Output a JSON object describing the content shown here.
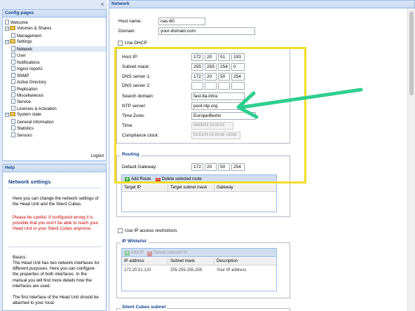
{
  "left": {
    "config_header": "Config pages",
    "collapse_icon": "«",
    "tree": [
      {
        "label": "Welcome",
        "icon": "page-icon"
      },
      {
        "label": "Volumes & Shares",
        "icon": "folder-icon"
      },
      {
        "label": "Management",
        "icon": "page-icon"
      },
      {
        "label": "Settings",
        "icon": "folder-icon"
      },
      {
        "label": "Network",
        "icon": "page-icon",
        "selected": true
      },
      {
        "label": "User",
        "icon": "page-icon"
      },
      {
        "label": "Notifications",
        "icon": "page-icon"
      },
      {
        "label": "Ingest reports",
        "icon": "page-icon"
      },
      {
        "label": "SNMP",
        "icon": "page-icon"
      },
      {
        "label": "Active Directory",
        "icon": "page-icon"
      },
      {
        "label": "Replication",
        "icon": "page-icon"
      },
      {
        "label": "Miscellaneous",
        "icon": "page-icon"
      },
      {
        "label": "Service",
        "icon": "page-icon"
      },
      {
        "label": "Licenses & Activation",
        "icon": "page-icon"
      },
      {
        "label": "System state",
        "icon": "folder-icon"
      },
      {
        "label": "General information",
        "icon": "page-icon"
      },
      {
        "label": "Statistics",
        "icon": "page-icon"
      },
      {
        "label": "Sensors",
        "icon": "page-icon"
      }
    ],
    "logout": "Logout",
    "help_header": "Help",
    "help_title": "Network settings",
    "help_p1": "Here you can change the network settings of the Head Unit and the Silent Cubes.",
    "help_warning": "Please be careful: if configured wrong it is possible that you won't be able to reach your Head Unit or your Silent Cubes anymore.",
    "help_basics_title": "Basics:",
    "help_p2": "The Head Unit has two network interfaces for different purposes. Here you can configure the properties of both interfaces. In the manual you will find more details how the interfaces are used.",
    "help_p3": "The first interface of the Head Unit should be attached to your local"
  },
  "main": {
    "header": "Network",
    "host_name_label": "Host name:",
    "host_name_value": "nas-60",
    "domain_label": "Domain:",
    "domain_value": "your-domain.com",
    "use_dhcp_label": "Use DHCP",
    "host_ip_label": "Host IP:",
    "host_ip": [
      "172",
      "20",
      "51",
      "193"
    ],
    "subnet_label": "Subnet mask:",
    "subnet": [
      "255",
      "255",
      "254",
      "0"
    ],
    "dns1_label": "DNS server 1:",
    "dns1": [
      "172",
      "20",
      "50",
      "254"
    ],
    "dns2_label": "DNS server 2:",
    "dns2": [
      "",
      "",
      "",
      ""
    ],
    "search_domain_label": "Search domain:",
    "search_domain_value": "fast-lta.intra",
    "ntp_label": "NTP server:",
    "ntp_value": "pool.ntp.org",
    "timezone_label": "Time Zone:",
    "timezone_value": "Europe/Berlin",
    "time_label": "Time:",
    "time_value": "04/05/23 10:00:52",
    "compliance_label": "Compliance clock:",
    "compliance_value": "01/01/70 01:00:36 +0100",
    "routing_legend": "Routing",
    "gateway_label": "Default Gateway:",
    "gateway": [
      "172",
      "20",
      "50",
      "254"
    ],
    "add_route": "Add Route",
    "delete_route": "Delete selected route",
    "route_cols": [
      "Target IP",
      "Target subnet mask",
      "Gateway"
    ],
    "use_ip_restrictions_label": "Use IP access restrictions",
    "whitelist_legend": "IP Whitelist",
    "add_ip": "Add IP",
    "delete_ip": "Delete selected IP",
    "whitelist_cols": [
      "IP address",
      "Subnet mask",
      "Description"
    ],
    "whitelist_rows": [
      [
        "172.20.51.120",
        "255.255.255.255",
        "Your IP address"
      ]
    ],
    "cutoff_legend": "Silent Cubes subnet"
  },
  "annotation": {
    "highlight_color": "#f2dc2a",
    "arrow_color": "#2fcf8f"
  }
}
